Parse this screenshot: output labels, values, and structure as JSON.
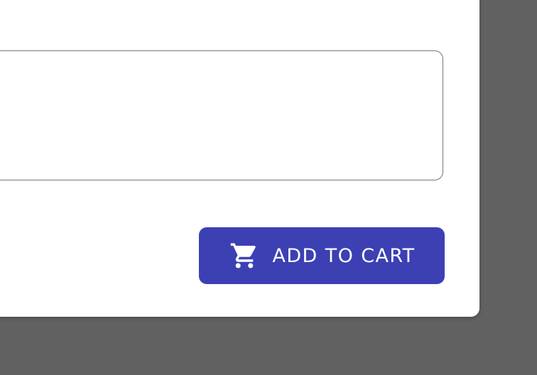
{
  "form": {
    "comment_value": "",
    "comment_placeholder": ""
  },
  "add_to_cart_button": {
    "label": "ADD TO CART",
    "icon": "cart-icon"
  },
  "colors": {
    "backdrop": "#616161",
    "card": "#ffffff",
    "field_border": "#757575",
    "button": "#3c40b3",
    "button_text": "#ffffff"
  }
}
